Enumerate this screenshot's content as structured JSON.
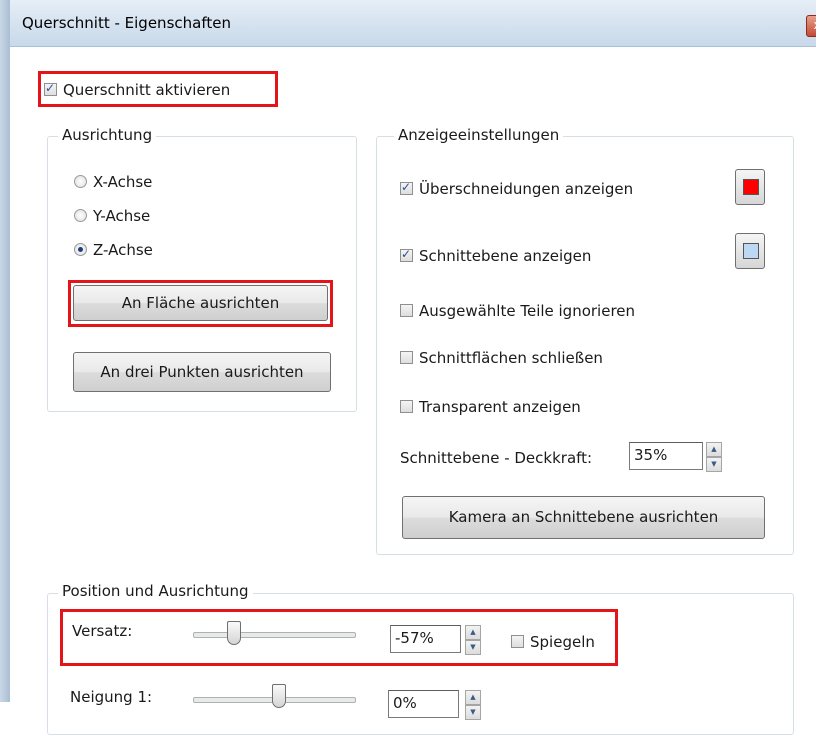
{
  "window": {
    "title": "Querschnitt - Eigenschaften",
    "close_glyph": "x"
  },
  "enable_section": {
    "label": "Querschnitt aktivieren",
    "checked": true
  },
  "orientation": {
    "group_label": "Ausrichtung",
    "options": [
      {
        "label": "X-Achse",
        "selected": false
      },
      {
        "label": "Y-Achse",
        "selected": false
      },
      {
        "label": "Z-Achse",
        "selected": true
      }
    ],
    "align_face_label": "An Fläche ausrichten",
    "align_three_points_label": "An drei Punkten ausrichten"
  },
  "display": {
    "group_label": "Anzeigeeinstellungen",
    "show_intersections": {
      "label": "Überschneidungen anzeigen",
      "checked": true,
      "color": "#ff0000"
    },
    "show_plane": {
      "label": "Schnittebene anzeigen",
      "checked": true,
      "color": "#bcd8f2"
    },
    "ignore_selected": {
      "label": "Ausgewählte Teile ignorieren",
      "checked": false
    },
    "close_faces": {
      "label": "Schnittflächen schließen",
      "checked": false
    },
    "transparent": {
      "label": "Transparent anzeigen",
      "checked": false
    },
    "opacity_label": "Schnittebene - Deckkraft:",
    "opacity_value": "35%",
    "camera_button_label": "Kamera an Schnittebene ausrichten"
  },
  "position": {
    "group_label": "Position und Ausrichtung",
    "offset": {
      "label": "Versatz:",
      "value": "-57%",
      "slider_fraction": 0.22
    },
    "mirror": {
      "label": "Spiegeln",
      "checked": false
    },
    "tilt1": {
      "label": "Neigung 1:",
      "value": "0%",
      "slider_fraction": 0.5
    }
  },
  "icons": {
    "check": "checkbox-check-icon",
    "radio": "radio-dot-icon",
    "spin_up": "▲",
    "spin_down": "▼"
  }
}
